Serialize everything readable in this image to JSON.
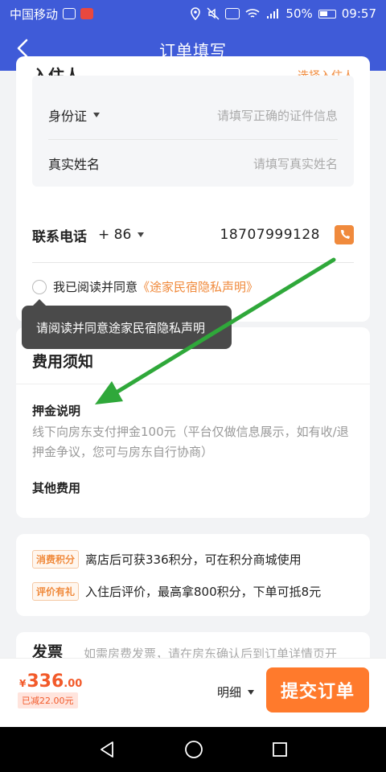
{
  "status_bar": {
    "carrier": "中国移动",
    "battery": "50%",
    "time": "09:57"
  },
  "nav": {
    "title": "订单填写"
  },
  "guest": {
    "title": "入住人",
    "link": "选择入住人",
    "id_type_label": "身份证",
    "id_placeholder": "请填写正确的证件信息",
    "name_label": "真实姓名",
    "name_placeholder": "请填写真实姓名"
  },
  "contact": {
    "label": "联系电话",
    "country_code": "+ 86",
    "phone": "18707999128"
  },
  "agreement": {
    "prefix": "我已阅读并同意",
    "link": "《途家民宿隐私声明》",
    "tooltip": "请阅读并同意途家民宿隐私声明"
  },
  "fees": {
    "title": "费用须知",
    "deposit_title": "押金说明",
    "deposit_desc": "线下向房东支付押金100元（平台仅做信息展示，如有收/退押金争议，您可与房东自行协商）",
    "other_title": "其他费用"
  },
  "points": {
    "badge1": "消费积分",
    "text1": "离店后可获336积分，可在积分商城使用",
    "badge2": "评价有礼",
    "text2": "入住后评价，最高拿800积分，下单可抵8元"
  },
  "invoice": {
    "title": "发票",
    "text": "如需房费发票，请在房东确认后到订单详情页开"
  },
  "bottom": {
    "currency": "¥",
    "price_int": "336",
    "price_dec": ".00",
    "discount": "已减22.00元",
    "detail": "明细",
    "submit": "提交订单"
  },
  "colors": {
    "primary": "#3f5bd8",
    "accent": "#f08a3c",
    "submit": "#ff7a2c",
    "arrow": "#2fa83a"
  }
}
